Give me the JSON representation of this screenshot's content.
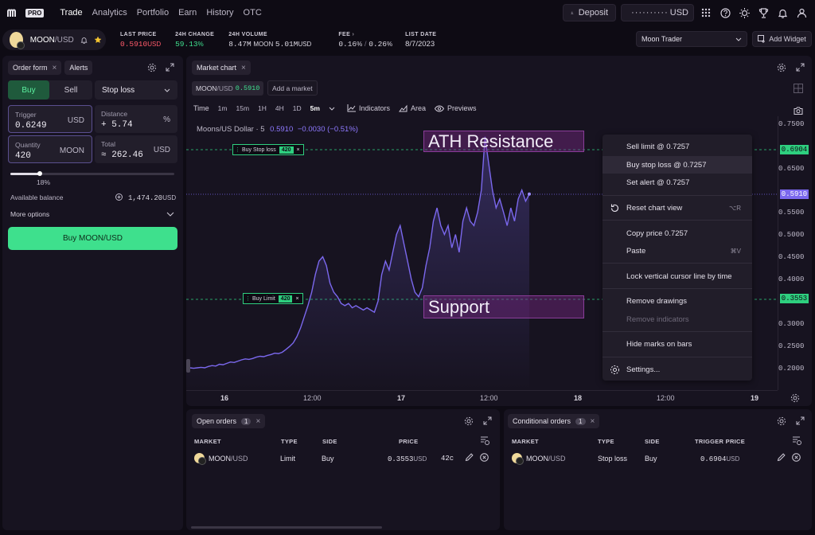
{
  "app": {
    "logo_text": "PRO",
    "nav": [
      "Trade",
      "Analytics",
      "Portfolio",
      "Earn",
      "History",
      "OTC"
    ],
    "deposit_label": "Deposit",
    "balance_masked": "··········",
    "balance_currency": "USD"
  },
  "ticker": {
    "pair_base": "MOON",
    "pair_quote": "/USD",
    "last_price_label": "LAST PRICE",
    "last_price": "0.5910",
    "last_price_unit": "USD",
    "change_label": "24H CHANGE",
    "change": "59.13",
    "change_unit": "%",
    "volume_label": "24H VOLUME",
    "volume_moon": "8.47M",
    "volume_moon_unit": "MOON",
    "volume_usd": "5.01M",
    "volume_usd_unit": "USD",
    "fee_label": "FEE",
    "fee_maker": "0.16",
    "fee_taker": "0.26",
    "fee_unit": "%",
    "list_date_label": "LIST DATE",
    "list_date": "8/7/2023",
    "account_select": "Moon Trader",
    "add_widget": "Add Widget"
  },
  "order_form": {
    "tab_order": "Order form",
    "tab_alerts": "Alerts",
    "buy": "Buy",
    "sell": "Sell",
    "type": "Stop loss",
    "trigger_label": "Trigger",
    "trigger_value": "0.6249",
    "trigger_unit": "USD",
    "distance_label": "Distance",
    "distance_value": "+ 5.74",
    "distance_unit": "%",
    "quantity_label": "Quantity",
    "quantity_value": "420",
    "quantity_unit": "MOON",
    "total_label": "Total",
    "total_value": "≈ 262.46",
    "total_unit": "USD",
    "slider_percent": "18%",
    "slider_fraction": 0.18,
    "available_label": "Available balance",
    "available_value": "1,474.20",
    "available_unit": "USD",
    "more_options": "More options",
    "submit": "Buy MOON/USD"
  },
  "chart": {
    "tab": "Market chart",
    "pair_chip_base": "MOON",
    "pair_chip_quote": "/USD",
    "pair_chip_price": "0.5910",
    "add_market": "Add a market",
    "time_label": "Time",
    "timeframes": [
      "1m",
      "15m",
      "1H",
      "4H",
      "1D",
      "5m"
    ],
    "active_timeframe": "5m",
    "indicators": "Indicators",
    "area": "Area",
    "previews": "Previews",
    "legend_title": "Moons/US Dollar · 5",
    "legend_price": "0.5910",
    "legend_change": "−0.0030 (−0.51%)",
    "stop_loss_label": "Buy Stop loss",
    "stop_loss_qty": "420",
    "buy_limit_label": "Buy Limit",
    "buy_limit_qty": "420",
    "ath_label": "ATH Resistance",
    "support_label": "Support",
    "y_ticks": [
      "0.7500",
      "0.7000",
      "0.6500",
      "0.6000",
      "0.5500",
      "0.5000",
      "0.4500",
      "0.4000",
      "0.3500",
      "0.3000",
      "0.2500",
      "0.2000"
    ],
    "x_ticks": [
      "16",
      "12:00",
      "17",
      "12:00",
      "18",
      "12:00",
      "19"
    ],
    "tag_stop": "0.6904",
    "tag_last": "0.5910",
    "tag_support": "0.3553",
    "colors": {
      "line": "#7b68ee",
      "green": "#2ecf7f",
      "purple": "#8f79ff"
    }
  },
  "chart_data": {
    "type": "area",
    "ylim": [
      0.17,
      0.76
    ],
    "y": [
      0.2,
      0.2,
      0.199,
      0.2,
      0.201,
      0.2,
      0.203,
      0.205,
      0.204,
      0.208,
      0.207,
      0.21,
      0.213,
      0.212,
      0.215,
      0.218,
      0.22,
      0.219,
      0.221,
      0.224,
      0.226,
      0.225,
      0.228,
      0.23,
      0.233,
      0.232,
      0.235,
      0.241,
      0.248,
      0.256,
      0.27,
      0.29,
      0.315,
      0.34,
      0.37,
      0.41,
      0.44,
      0.45,
      0.43,
      0.39,
      0.37,
      0.36,
      0.345,
      0.34,
      0.345,
      0.335,
      0.34,
      0.335,
      0.33,
      0.335,
      0.33,
      0.325,
      0.35,
      0.41,
      0.44,
      0.42,
      0.46,
      0.5,
      0.52,
      0.48,
      0.44,
      0.4,
      0.37,
      0.36,
      0.38,
      0.43,
      0.47,
      0.53,
      0.56,
      0.52,
      0.5,
      0.52,
      0.47,
      0.5,
      0.46,
      0.53,
      0.56,
      0.53,
      0.52,
      0.55,
      0.6,
      0.72,
      0.66,
      0.6,
      0.56,
      0.58,
      0.55,
      0.52,
      0.56,
      0.53,
      0.58,
      0.6,
      0.575,
      0.591
    ]
  },
  "context_menu": {
    "items": [
      {
        "label": "Sell limit @ 0.7257",
        "shortcut": ""
      },
      {
        "label": "Buy stop loss @ 0.7257",
        "shortcut": ""
      },
      {
        "label": "Set alert @ 0.7257",
        "shortcut": ""
      },
      {
        "label": "Reset chart view",
        "shortcut": "⌥R"
      },
      {
        "label": "Copy price 0.7257",
        "shortcut": ""
      },
      {
        "label": "Paste",
        "shortcut": "⌘V"
      },
      {
        "label": "Lock vertical cursor line by time",
        "shortcut": ""
      },
      {
        "label": "Remove drawings",
        "shortcut": ""
      },
      {
        "label": "Remove indicators",
        "shortcut": ""
      },
      {
        "label": "Hide marks on bars",
        "shortcut": ""
      },
      {
        "label": "Settings...",
        "shortcut": ""
      }
    ]
  },
  "open_orders": {
    "tab": "Open orders",
    "count": "1",
    "headers": [
      "MARKET",
      "TYPE",
      "SIDE",
      "PRICE"
    ],
    "row": {
      "market": "MOON",
      "quote": "/USD",
      "type": "Limit",
      "side": "Buy",
      "price": "0.3553",
      "price_unit": "USD",
      "qty": "42с"
    }
  },
  "conditional_orders": {
    "tab": "Conditional orders",
    "count": "1",
    "headers": [
      "MARKET",
      "TYPE",
      "SIDE",
      "TRIGGER PRICE"
    ],
    "row": {
      "market": "MOON",
      "quote": "/USD",
      "type": "Stop loss",
      "side": "Buy",
      "price": "0.6904",
      "price_unit": "USD"
    }
  }
}
